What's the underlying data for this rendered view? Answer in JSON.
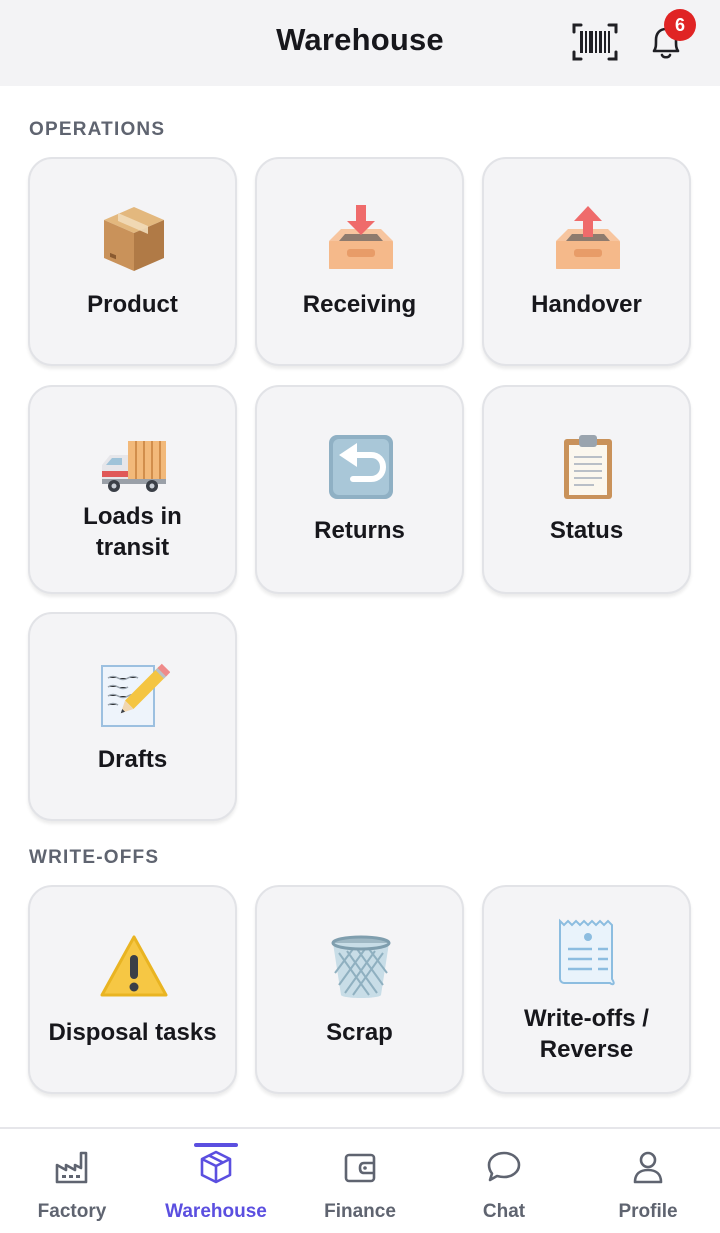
{
  "header": {
    "title": "Warehouse",
    "notification_count": "6"
  },
  "sections": {
    "operations": {
      "label": "OPERATIONS"
    },
    "writeoffs": {
      "label": "WRITE-OFFS"
    }
  },
  "tiles": {
    "product": {
      "label": "Product",
      "icon": "package-box-icon"
    },
    "receiving": {
      "label": "Receiving",
      "icon": "inbox-down-icon"
    },
    "handover": {
      "label": "Handover",
      "icon": "outbox-up-icon"
    },
    "loads": {
      "label_line1": "Loads in",
      "label_line2": "transit",
      "icon": "delivery-truck-icon"
    },
    "returns": {
      "label": "Returns",
      "icon": "return-arrow-icon"
    },
    "status": {
      "label": "Status",
      "icon": "clipboard-icon"
    },
    "drafts": {
      "label": "Drafts",
      "icon": "memo-pencil-icon"
    },
    "disposal": {
      "label": "Disposal tasks",
      "icon": "warning-icon"
    },
    "scrap": {
      "label": "Scrap",
      "icon": "wastebasket-icon"
    },
    "writeoffs_reverse": {
      "label_line1": "Write-offs /",
      "label_line2": "Reverse",
      "icon": "receipt-icon"
    }
  },
  "nav": {
    "factory": "Factory",
    "warehouse": "Warehouse",
    "finance": "Finance",
    "chat": "Chat",
    "profile": "Profile",
    "active": "warehouse"
  },
  "colors": {
    "accent": "#5b4fe0",
    "badge": "#e02424",
    "tile_bg": "#f4f4f6"
  }
}
